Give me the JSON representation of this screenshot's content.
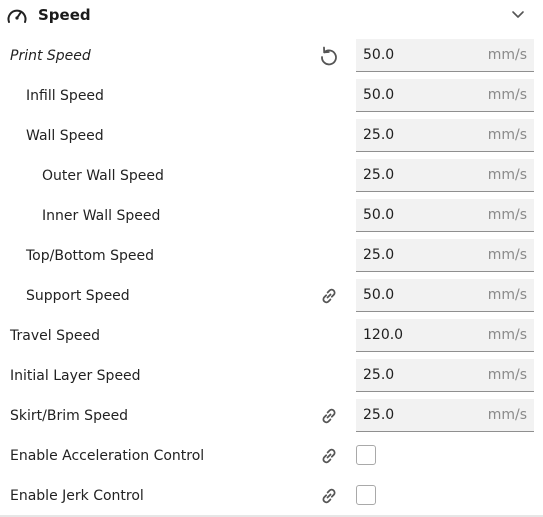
{
  "section": {
    "title": "Speed",
    "icon": "gauge-icon",
    "toggle_icon": "chevron-down-icon"
  },
  "settings": [
    {
      "label": "Print Speed",
      "value": "50.0",
      "unit": "mm/s",
      "icon": "reset-icon"
    },
    {
      "label": "Infill Speed",
      "value": "50.0",
      "unit": "mm/s"
    },
    {
      "label": "Wall Speed",
      "value": "25.0",
      "unit": "mm/s"
    },
    {
      "label": "Outer Wall Speed",
      "value": "25.0",
      "unit": "mm/s"
    },
    {
      "label": "Inner Wall Speed",
      "value": "50.0",
      "unit": "mm/s"
    },
    {
      "label": "Top/Bottom Speed",
      "value": "25.0",
      "unit": "mm/s"
    },
    {
      "label": "Support Speed",
      "value": "50.0",
      "unit": "mm/s",
      "icon": "link-icon"
    },
    {
      "label": "Travel Speed",
      "value": "120.0",
      "unit": "mm/s"
    },
    {
      "label": "Initial Layer Speed",
      "value": "25.0",
      "unit": "mm/s"
    },
    {
      "label": "Skirt/Brim Speed",
      "value": "25.0",
      "unit": "mm/s",
      "icon": "link-icon"
    },
    {
      "label": "Enable Acceleration Control",
      "checked": false,
      "icon": "link-icon"
    },
    {
      "label": "Enable Jerk Control",
      "checked": false,
      "icon": "link-icon"
    }
  ]
}
